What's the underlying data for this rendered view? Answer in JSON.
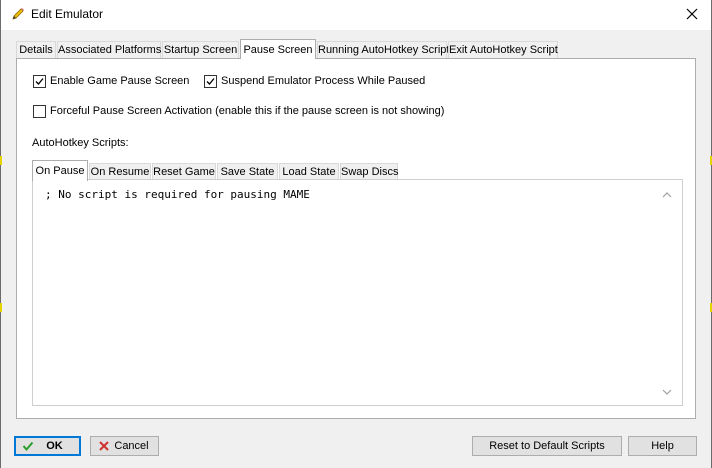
{
  "window": {
    "title": "Edit Emulator"
  },
  "tabs": [
    {
      "label": "Details"
    },
    {
      "label": "Associated Platforms"
    },
    {
      "label": "Startup Screen"
    },
    {
      "label": "Pause Screen"
    },
    {
      "label": "Running AutoHotkey Script"
    },
    {
      "label": "Exit AutoHotkey Script"
    }
  ],
  "active_tab": "Pause Screen",
  "pause_screen": {
    "enable_pause": {
      "label": "Enable Game Pause Screen",
      "checked": true
    },
    "suspend_process": {
      "label": "Suspend Emulator Process While Paused",
      "checked": true
    },
    "forceful_activation": {
      "label": "Forceful Pause Screen Activation (enable this if the pause screen is not showing)",
      "checked": false
    },
    "scripts_label": "AutoHotkey Scripts:",
    "script_tabs": [
      {
        "label": "On Pause"
      },
      {
        "label": "On Resume"
      },
      {
        "label": "Reset Game"
      },
      {
        "label": "Save State"
      },
      {
        "label": "Load State"
      },
      {
        "label": "Swap Discs"
      }
    ],
    "active_script_tab": "On Pause",
    "script_text": "; No script is required for pausing MAME"
  },
  "buttons": {
    "ok": "OK",
    "cancel": "Cancel",
    "reset_scripts": "Reset to Default Scripts",
    "help": "Help"
  },
  "colors": {
    "accent": "#0078d7",
    "ok_check": "#2a9d2a",
    "cancel_x": "#d03030"
  }
}
